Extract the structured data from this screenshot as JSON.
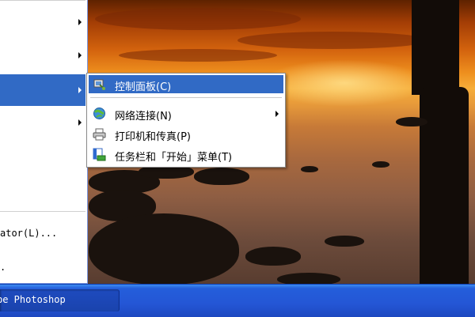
{
  "start_menu": {
    "items": [
      {
        "has_submenu": true
      },
      {
        "has_submenu": true
      },
      {
        "has_submenu": true,
        "selected": true
      },
      {
        "has_submenu": true
      }
    ],
    "run_as_label": "ator(L)...",
    "last_item_label": "."
  },
  "submenu": {
    "items": [
      {
        "label": "控制面板(C)",
        "icon": "control-panel-icon",
        "highlighted": true,
        "has_submenu": false
      },
      {
        "label": "网络连接(N)",
        "icon": "network-connections-icon",
        "highlighted": false,
        "has_submenu": true
      },
      {
        "label": "打印机和传真(P)",
        "icon": "printers-faxes-icon",
        "highlighted": false,
        "has_submenu": false
      },
      {
        "label": "任务栏和「开始」菜单(T)",
        "icon": "taskbar-start-menu-icon",
        "highlighted": false,
        "has_submenu": false
      }
    ]
  },
  "taskbar": {
    "task_button_label": "be Photoshop"
  },
  "colors": {
    "selection": "#316ac5",
    "taskbar": "#245edb",
    "menu_background": "#ffffff"
  }
}
